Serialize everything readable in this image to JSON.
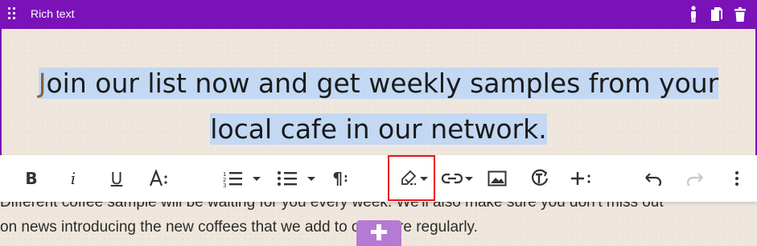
{
  "block": {
    "title": "Rich text",
    "accent_color": "#7a12b8",
    "icons": [
      "drag-handle-icon",
      "figure-icon",
      "copy-icon",
      "trash-icon"
    ]
  },
  "headline": {
    "first_letter": "J",
    "line1_rest": "oin our list now and get weekly samples from your",
    "line2": "local cafe in our network."
  },
  "paragraph": {
    "line1": "Different coffee sample will be waiting for you every week. We'll also make sure you don't miss out",
    "line2": "on news introducing the new coffees that we add to our store regularly."
  },
  "toolbar": {
    "bold": "B",
    "italic": "i",
    "underline": "U",
    "font_size": "A↓",
    "paragraph": "¶",
    "items": [
      "bold",
      "italic",
      "underline",
      "font-size",
      "ordered-list",
      "bullet-list",
      "paragraph-format",
      "highlight-color",
      "link",
      "image",
      "text-transform",
      "insert-more",
      "undo",
      "redo",
      "more-options"
    ],
    "highlighted_item": "highlight-color",
    "highlight_border_color": "#e8141a"
  }
}
